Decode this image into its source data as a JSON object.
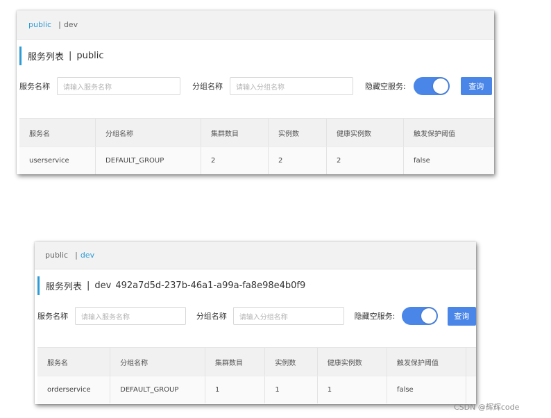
{
  "panels": [
    {
      "namespace_tabs": {
        "public": "public",
        "sep": "|",
        "dev": "dev"
      },
      "title": {
        "text": "服务列表",
        "sep": "|",
        "namespace": "public",
        "namespace_id": ""
      },
      "filters": {
        "service_label": "服务名称",
        "service_placeholder": "请输入服务名称",
        "group_label": "分组名称",
        "group_placeholder": "请输入分组名称",
        "hide_empty_label": "隐藏空服务:",
        "hide_empty_on": true,
        "query_label": "查询"
      },
      "table": {
        "headers": [
          "服务名",
          "分组名称",
          "集群数目",
          "实例数",
          "健康实例数",
          "触发保护阈值"
        ],
        "rows": [
          [
            "userservice",
            "DEFAULT_GROUP",
            "2",
            "2",
            "2",
            "false"
          ]
        ]
      }
    },
    {
      "namespace_tabs": {
        "public": "public",
        "sep": "|",
        "dev": "dev"
      },
      "title": {
        "text": "服务列表",
        "sep": "|",
        "namespace": "dev",
        "namespace_id": "492a7d5d-237b-46a1-a99a-fa8e98e4b0f9"
      },
      "filters": {
        "service_label": "服务名称",
        "service_placeholder": "请输入服务名称",
        "group_label": "分组名称",
        "group_placeholder": "请输入分组名称",
        "hide_empty_label": "隐藏空服务:",
        "hide_empty_on": true,
        "query_label": "查询"
      },
      "table": {
        "headers": [
          "服务名",
          "分组名称",
          "集群数目",
          "实例数",
          "健康实例数",
          "触发保护阈值"
        ],
        "rows": [
          [
            "orderservice",
            "DEFAULT_GROUP",
            "1",
            "1",
            "1",
            "false"
          ]
        ]
      }
    }
  ],
  "watermark": "CSDN @辉辉code",
  "colors": {
    "accent": "#2c9bd6",
    "primary": "#4a86e8"
  }
}
